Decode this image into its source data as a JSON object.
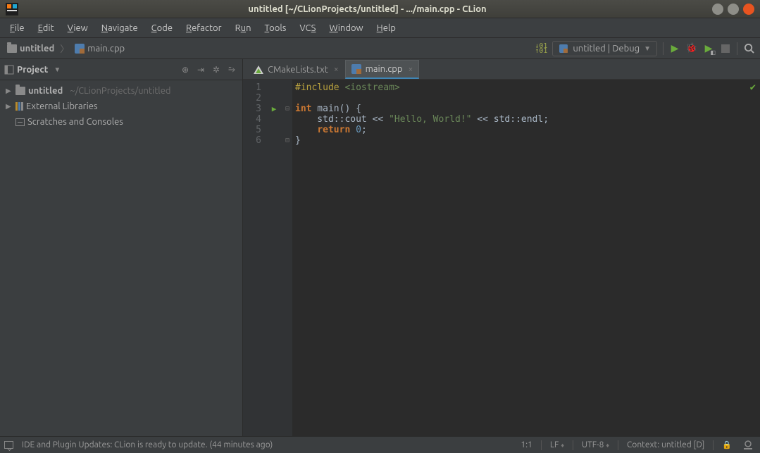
{
  "titlebar": {
    "title": "untitled [~/CLionProjects/untitled] - .../main.cpp - CLion"
  },
  "menu": [
    "File",
    "Edit",
    "View",
    "Navigate",
    "Code",
    "Refactor",
    "Run",
    "Tools",
    "VCS",
    "Window",
    "Help"
  ],
  "breadcrumb": {
    "project": "untitled",
    "file": "main.cpp"
  },
  "run_config": {
    "label": "untitled | Debug"
  },
  "project_panel": {
    "title": "Project",
    "root": {
      "name": "untitled",
      "path": "~/CLionProjects/untitled"
    },
    "external": "External Libraries",
    "scratches": "Scratches and Consoles"
  },
  "tabs": [
    {
      "label": "CMakeLists.txt",
      "active": false
    },
    {
      "label": "main.cpp",
      "active": true
    }
  ],
  "code": {
    "lines": [
      "1",
      "2",
      "3",
      "4",
      "5",
      "6"
    ],
    "l1_a": "#include",
    "l1_b": " <iostream>",
    "l3_a": "int",
    "l3_b": " main() {",
    "l4_a": "    std::cout << ",
    "l4_b": "\"Hello, World!\"",
    "l4_c": " << std::endl;",
    "l5_a": "    ",
    "l5_b": "return",
    "l5_c": " ",
    "l5_d": "0",
    "l5_e": ";",
    "l6": "}"
  },
  "status": {
    "message": "IDE and Plugin Updates: CLion is ready to update. (44 minutes ago)",
    "pos": "1:1",
    "eol": "LF",
    "enc": "UTF-8",
    "context": "Context: untitled [D]"
  }
}
